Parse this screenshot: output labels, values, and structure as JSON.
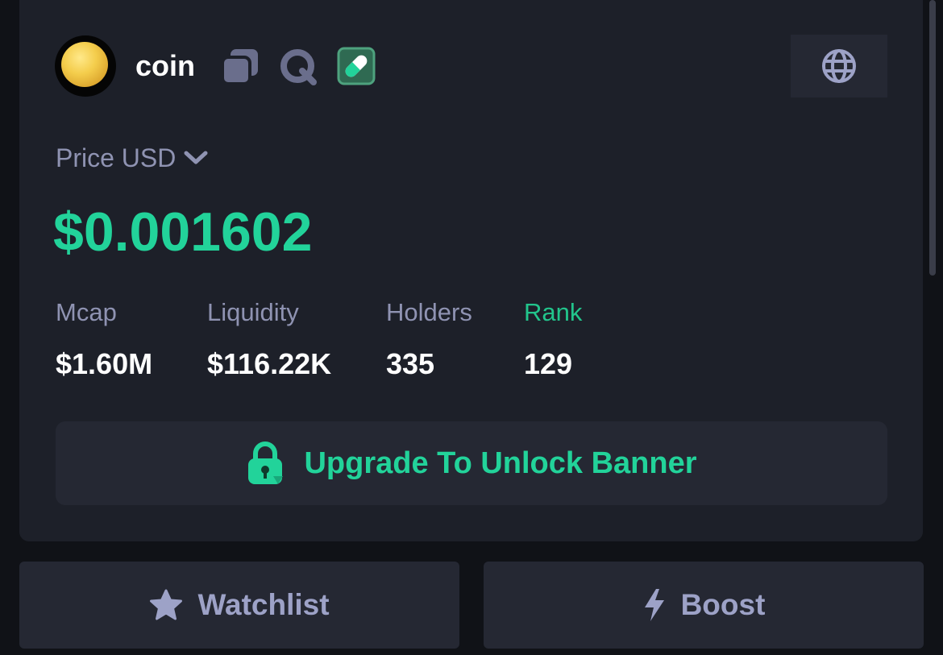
{
  "token": {
    "name": "coin",
    "icons": [
      "copy-icon",
      "search-icon",
      "pill-icon",
      "globe-icon"
    ]
  },
  "price": {
    "label": "Price USD",
    "value": "$0.001602"
  },
  "stats": [
    {
      "label": "Mcap",
      "value": "$1.60M"
    },
    {
      "label": "Liquidity",
      "value": "$116.22K"
    },
    {
      "label": "Holders",
      "value": "335"
    },
    {
      "label": "Rank",
      "value": "129"
    }
  ],
  "banner": {
    "label": "Upgrade To Unlock Banner",
    "icon": "lock-icon"
  },
  "actions": {
    "watchlist_label": "Watchlist",
    "watchlist_icon": "star-icon",
    "boost_label": "Boost",
    "boost_icon": "lightning-icon"
  },
  "colors": {
    "accent": "#22d39a",
    "card": "#1d2029",
    "muted_text": "#8f93b2"
  }
}
